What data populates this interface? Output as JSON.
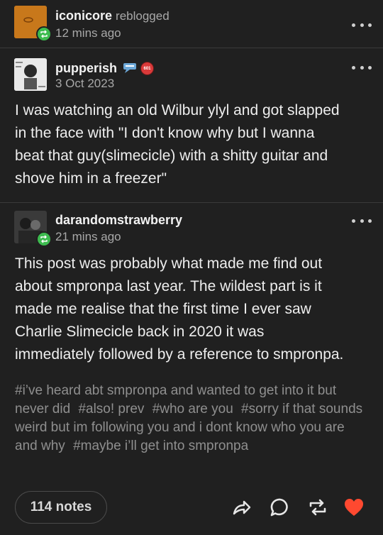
{
  "reblogger": {
    "username": "iconicore",
    "action": "reblogged",
    "time": "12 mins ago"
  },
  "op": {
    "username": "pupperish",
    "date": "3 Oct 2023",
    "badge_text": "601"
  },
  "op_text": "I was watching an old Wilbur ylyl and got slapped\nin the face with \"I don't know why but I wanna\nbeat that guy(slimecicle) with a shitty guitar and\nshove him in a freezer\"",
  "reply": {
    "username": "darandomstrawberry",
    "time": "21 mins ago"
  },
  "reply_text": "This post was probably what made me find out\nabout smpronpa last year. The wildest part is it\nmade me realise that the first time I ever saw\nCharlie Slimecicle back in 2020 it was\nimmediately followed by a reference to smpronpa.",
  "tags": [
    "#i’ve heard abt smpronpa and wanted to get into it but never did",
    "#also! prev",
    "#who are you",
    "#sorry if that sounds weird but im following you and i dont know who you are and why",
    "#maybe i’ll get into smpronpa"
  ],
  "footer": {
    "notes_label": "114 notes"
  },
  "icons": {
    "share": "share-icon",
    "reply": "reply-icon",
    "reblog": "reblog-icon",
    "like": "heart-icon"
  },
  "colors": {
    "background": "#202020",
    "reblog_badge": "#3dbb4f",
    "like": "#ff4930",
    "tag_text": "#8f8f8f"
  }
}
